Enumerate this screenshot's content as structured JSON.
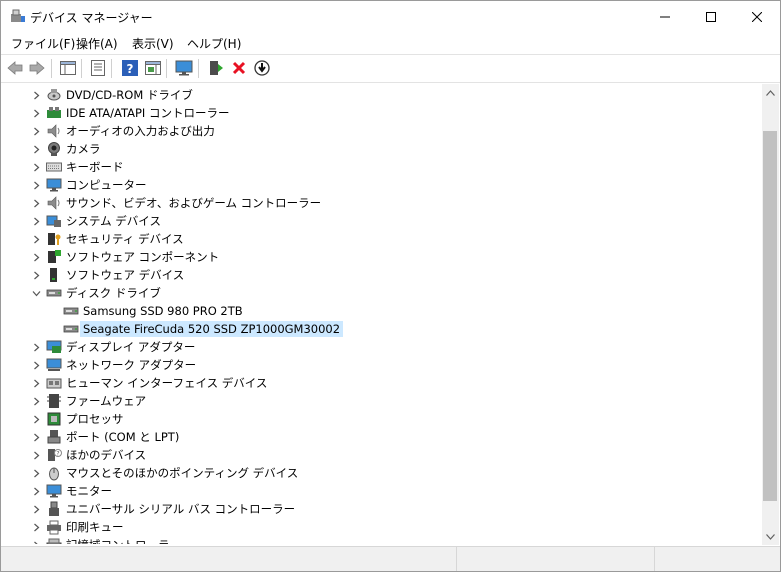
{
  "window": {
    "title": "デバイス マネージャー"
  },
  "menu": [
    "ファイル(F)",
    "操作(A)",
    "表示(V)",
    "ヘルプ(H)"
  ],
  "tree": [
    {
      "label": "DVD/CD-ROM ドライブ",
      "icon": "dvd-drive-icon",
      "level": 0,
      "expanded": false
    },
    {
      "label": "IDE ATA/ATAPI コントローラー",
      "icon": "ide-controller-icon",
      "level": 0,
      "expanded": false
    },
    {
      "label": "オーディオの入力および出力",
      "icon": "speaker-icon",
      "level": 0,
      "expanded": false
    },
    {
      "label": "カメラ",
      "icon": "camera-icon",
      "level": 0,
      "expanded": false
    },
    {
      "label": "キーボード",
      "icon": "keyboard-icon",
      "level": 0,
      "expanded": false
    },
    {
      "label": "コンピューター",
      "icon": "monitor-icon",
      "level": 0,
      "expanded": false
    },
    {
      "label": "サウンド、ビデオ、およびゲーム コントローラー",
      "icon": "speaker-icon",
      "level": 0,
      "expanded": false
    },
    {
      "label": "システム デバイス",
      "icon": "system-device-icon",
      "level": 0,
      "expanded": false
    },
    {
      "label": "セキュリティ デバイス",
      "icon": "security-device-icon",
      "level": 0,
      "expanded": false
    },
    {
      "label": "ソフトウェア コンポーネント",
      "icon": "software-component-icon",
      "level": 0,
      "expanded": false
    },
    {
      "label": "ソフトウェア デバイス",
      "icon": "software-device-icon",
      "level": 0,
      "expanded": false
    },
    {
      "label": "ディスク ドライブ",
      "icon": "disk-drive-icon",
      "level": 0,
      "expanded": true
    },
    {
      "label": "Samsung SSD 980 PRO 2TB",
      "icon": "disk-drive-icon",
      "level": 1,
      "leaf": true
    },
    {
      "label": "Seagate FireCuda 520 SSD ZP1000GM30002",
      "icon": "disk-drive-icon",
      "level": 1,
      "leaf": true,
      "selected": true
    },
    {
      "label": "ディスプレイ アダプター",
      "icon": "display-adapter-icon",
      "level": 0,
      "expanded": false
    },
    {
      "label": "ネットワーク アダプター",
      "icon": "network-adapter-icon",
      "level": 0,
      "expanded": false
    },
    {
      "label": "ヒューマン インターフェイス デバイス",
      "icon": "hid-icon",
      "level": 0,
      "expanded": false
    },
    {
      "label": "ファームウェア",
      "icon": "firmware-icon",
      "level": 0,
      "expanded": false
    },
    {
      "label": "プロセッサ",
      "icon": "processor-icon",
      "level": 0,
      "expanded": false
    },
    {
      "label": "ポート (COM と LPT)",
      "icon": "port-icon",
      "level": 0,
      "expanded": false
    },
    {
      "label": "ほかのデバイス",
      "icon": "other-device-icon",
      "level": 0,
      "expanded": false
    },
    {
      "label": "マウスとそのほかのポインティング デバイス",
      "icon": "mouse-icon",
      "level": 0,
      "expanded": false
    },
    {
      "label": "モニター",
      "icon": "monitor-icon",
      "level": 0,
      "expanded": false
    },
    {
      "label": "ユニバーサル シリアル バス コントローラー",
      "icon": "usb-icon",
      "level": 0,
      "expanded": false
    },
    {
      "label": "印刷キュー",
      "icon": "printer-icon",
      "level": 0,
      "expanded": false
    },
    {
      "label": "記憶域コントローラー",
      "icon": "storage-controller-icon",
      "level": 0,
      "expanded": false
    }
  ],
  "colors": {
    "selection": "#cce8ff",
    "accent": "#0078d7",
    "uninstall": "#e81123"
  }
}
